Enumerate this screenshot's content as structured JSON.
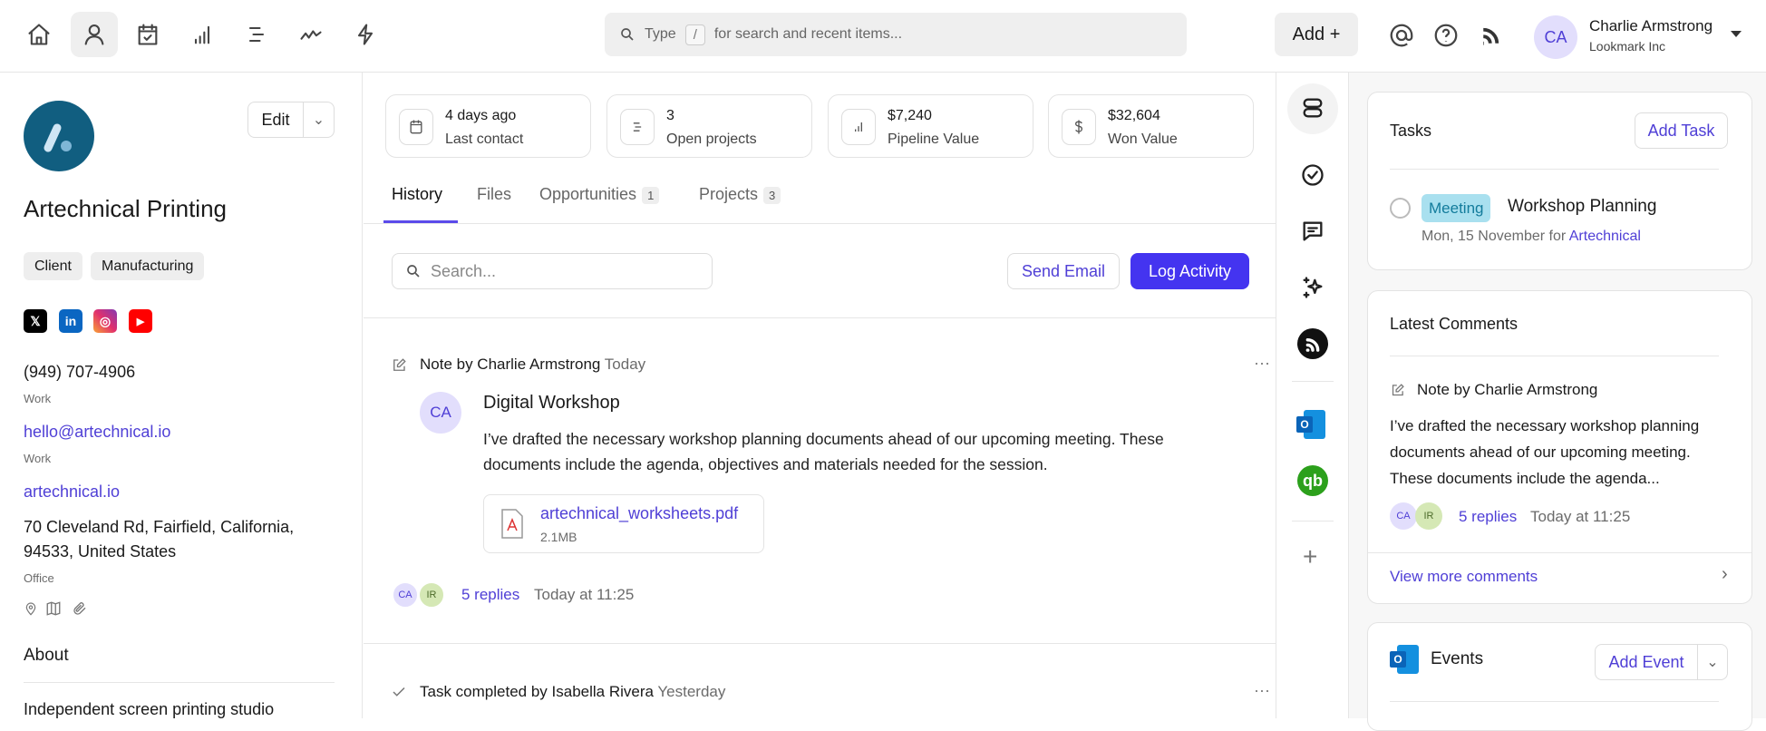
{
  "topbar": {
    "search_type": "Type",
    "search_key": "/",
    "search_hint": "for search and recent items...",
    "add_label": "Add +",
    "user": {
      "initials": "CA",
      "name": "Charlie Armstrong",
      "company": "Lookmark Inc"
    }
  },
  "company": {
    "name": "Artechnical Printing",
    "edit_label": "Edit",
    "tags": [
      "Client",
      "Manufacturing"
    ],
    "phone": "(949) 707-4906",
    "phone_type": "Work",
    "email": "hello@artechnical.io",
    "email_type": "Work",
    "website": "artechnical.io",
    "address_line1": "70 Cleveland Rd, Fairfield, California,",
    "address_line2": "94533, United States",
    "address_type": "Office",
    "about_title": "About",
    "about_text": "Independent screen printing studio"
  },
  "stats": [
    {
      "value": "4 days ago",
      "label": "Last contact"
    },
    {
      "value": "3",
      "label": "Open projects"
    },
    {
      "value": "$7,240",
      "label": "Pipeline Value"
    },
    {
      "value": "$32,604",
      "label": "Won Value"
    }
  ],
  "tabs": [
    {
      "label": "History"
    },
    {
      "label": "Files"
    },
    {
      "label": "Opportunities",
      "count": "1"
    },
    {
      "label": "Projects",
      "count": "3"
    }
  ],
  "history": {
    "search_placeholder": "Search...",
    "send_email": "Send Email",
    "log_activity": "Log Activity",
    "note": {
      "header": "Note by Charlie Armstrong",
      "when": "Today",
      "author_initials": "CA",
      "title": "Digital Workshop",
      "body1": "I’ve drafted the necessary workshop planning documents ahead of our upcoming meeting. These",
      "body2": "documents include the agenda, objectives and materials needed for the session.",
      "file_name": "artechnical_worksheets.pdf",
      "file_size": "2.1MB",
      "reply_avatars": [
        "CA",
        "IR"
      ],
      "replies": "5 replies",
      "reply_time": "Today at 11:25"
    },
    "task": {
      "header": "Task completed by Isabella Rivera",
      "when": "Yesterday"
    }
  },
  "tasks": {
    "title": "Tasks",
    "add_label": "Add Task",
    "item": {
      "tag": "Meeting",
      "title": "Workshop Planning",
      "date": "Mon, 15 November for",
      "link": "Artechnical"
    }
  },
  "comments": {
    "title": "Latest Comments",
    "note_header": "Note by Charlie Armstrong",
    "line1": "I’ve drafted the necessary workshop planning",
    "line2": "documents ahead of our upcoming meeting.",
    "line3": "These documents include the agenda...",
    "avatars": [
      "CA",
      "IR"
    ],
    "replies": "5 replies",
    "time": "Today at 11:25",
    "view_more": "View more comments"
  },
  "events": {
    "title": "Events",
    "add_label": "Add Event"
  },
  "colors": {
    "accent": "#4f3fd6",
    "primary_button": "#4434f0"
  }
}
